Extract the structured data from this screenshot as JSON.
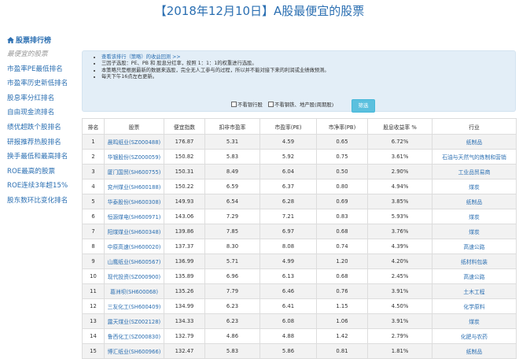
{
  "page_title": "【2018年12月10日】A股最便宜的股票",
  "sidebar": {
    "header": "股票排行榜",
    "header_icon": "home-icon",
    "items": [
      {
        "label": "最便宜的股票",
        "active": true
      },
      {
        "label": "市盈率PE最低排名"
      },
      {
        "label": "市盈率历史新低排名"
      },
      {
        "label": "股息率分红排名"
      },
      {
        "label": "自由现金流排名"
      },
      {
        "label": "绩优超跌个股排名"
      },
      {
        "label": "研报推荐热股排名"
      },
      {
        "label": "换手最低和最高排名"
      },
      {
        "label": "ROE最高的股票"
      },
      {
        "label": "ROE连续3年超15%"
      },
      {
        "label": "股东数环比变化排名"
      }
    ]
  },
  "info": {
    "link": "查看该排行（策略）的收益回测 >>",
    "lines": [
      "三因子选股：PE、PB 和 股息分红率，按照 1：1：1的权重进行选股。",
      "本策略只是根据最新的数据来选股，完全无人工参与的过程，所以并不能对接下来的利润或业绩做预测。",
      "每天下午16点左右更新。"
    ]
  },
  "filters": {
    "bank_label": "不看银行股",
    "steel_label": "不看钢铁、地产股(周期股)",
    "button_label": "筛选"
  },
  "table": {
    "headers": [
      "排名",
      "股票",
      "便宜指数",
      "扣非市盈率",
      "市盈率(PE)",
      "市净率(PB)",
      "股息收益率 %",
      "行业"
    ],
    "rows": [
      [
        "1",
        "晨鸣纸业(SZ000488)",
        "176.87",
        "5.31",
        "4.59",
        "0.65",
        "6.72%",
        "纸制品"
      ],
      [
        "2",
        "华银股份(SZ000059)",
        "150.82",
        "5.83",
        "5.92",
        "0.75",
        "3.61%",
        "石油与天然气的炼制和营销"
      ],
      [
        "3",
        "厦门国贸(SH600755)",
        "150.31",
        "8.49",
        "6.04",
        "0.50",
        "2.90%",
        "工业品贸易商"
      ],
      [
        "4",
        "兖州煤业(SH600188)",
        "150.22",
        "6.59",
        "6.37",
        "0.80",
        "4.94%",
        "煤炭"
      ],
      [
        "5",
        "华泰股份(SH600308)",
        "149.93",
        "6.54",
        "6.28",
        "0.69",
        "3.85%",
        "纸制品"
      ],
      [
        "6",
        "恒源煤电(SH600971)",
        "143.06",
        "7.29",
        "7.21",
        "0.83",
        "5.93%",
        "煤炭"
      ],
      [
        "7",
        "阳煤煤业(SH600348)",
        "139.86",
        "7.85",
        "6.97",
        "0.68",
        "3.76%",
        "煤炭"
      ],
      [
        "8",
        "中原高速(SH600020)",
        "137.37",
        "8.30",
        "8.08",
        "0.74",
        "4.39%",
        "高速公路"
      ],
      [
        "9",
        "山鹰纸业(SH600567)",
        "136.99",
        "5.71",
        "4.99",
        "1.20",
        "4.20%",
        "纸材料包装"
      ],
      [
        "10",
        "现代投资(SZ000900)",
        "135.89",
        "6.96",
        "6.13",
        "0.68",
        "2.45%",
        "高速公路"
      ],
      [
        "11",
        "葛洲坝(SH600068)",
        "135.26",
        "7.79",
        "6.46",
        "0.76",
        "3.91%",
        "土木工程"
      ],
      [
        "12",
        "三友化工(SH600409)",
        "134.99",
        "6.23",
        "6.41",
        "1.15",
        "4.50%",
        "化学原料"
      ],
      [
        "13",
        "露天煤业(SZ002128)",
        "134.33",
        "6.23",
        "6.08",
        "1.06",
        "3.91%",
        "煤炭"
      ],
      [
        "14",
        "鲁西化工(SZ000830)",
        "132.79",
        "4.86",
        "4.88",
        "1.42",
        "2.79%",
        "化肥与农药"
      ],
      [
        "15",
        "博汇纸业(SH600966)",
        "132.47",
        "5.83",
        "5.86",
        "0.81",
        "1.81%",
        "纸制品"
      ]
    ]
  }
}
